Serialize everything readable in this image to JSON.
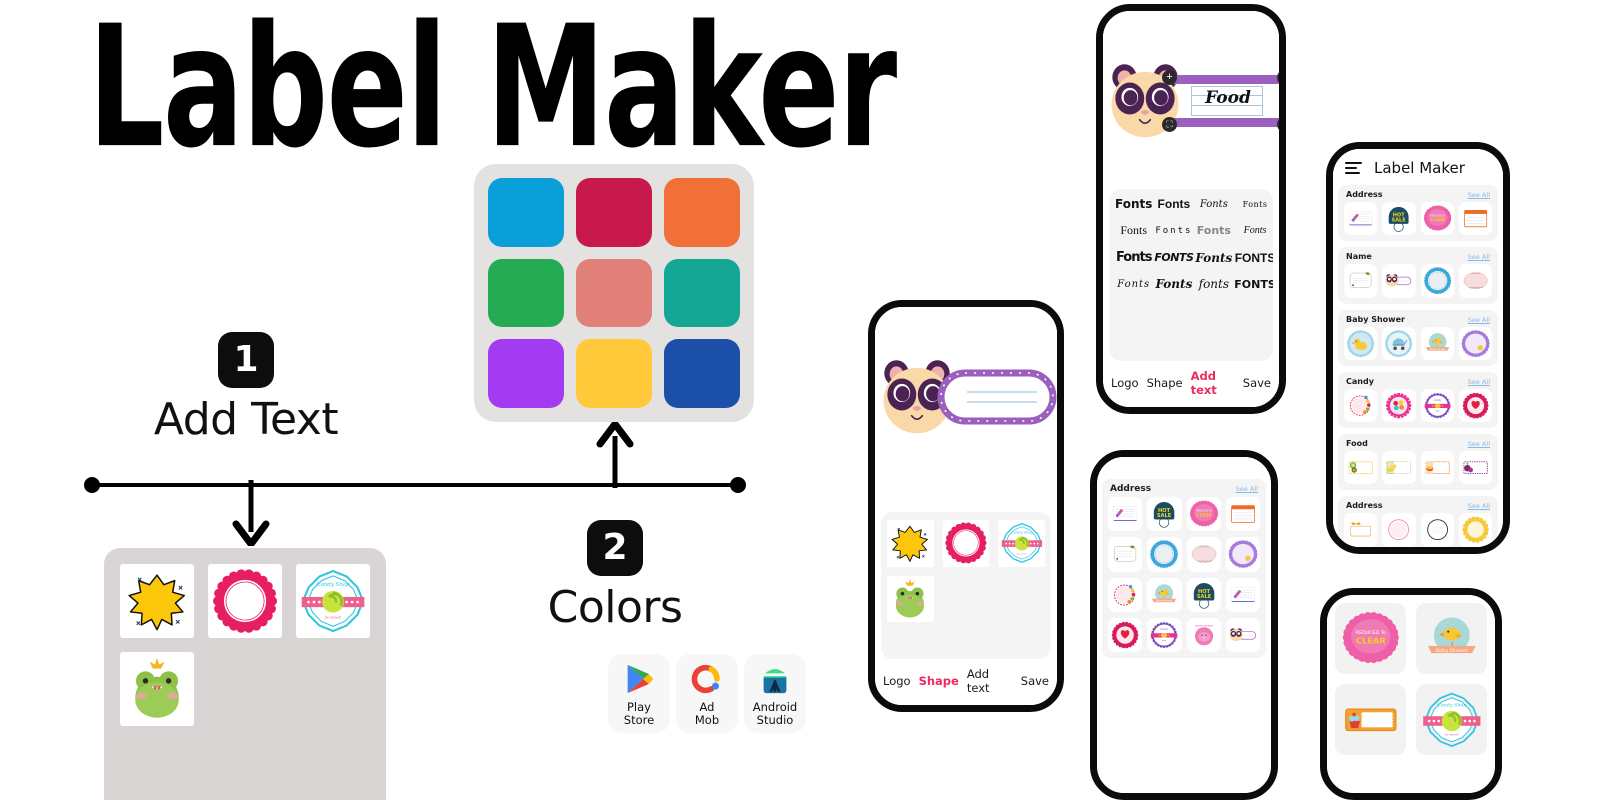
{
  "hero": {
    "title": "Label Maker"
  },
  "steps": [
    {
      "number": "1",
      "label": "Add Text"
    },
    {
      "number": "2",
      "label": "Colors"
    }
  ],
  "palette": {
    "name": "color-palette",
    "colors": [
      "#0a9fd8",
      "#c8194c",
      "#f07038",
      "#25ab53",
      "#e08079",
      "#15a795",
      "#a33cf0",
      "#ffc93a",
      "#1b4fa8"
    ]
  },
  "shape_panel": {
    "thumbnails": [
      {
        "name": "starburst-shape",
        "kind": "starburst"
      },
      {
        "name": "pink-circle-frame-shape",
        "kind": "pinkcircle"
      },
      {
        "name": "candy-badge-shape",
        "kind": "candybadge"
      },
      {
        "name": "frog-logo-shape",
        "kind": "frog"
      }
    ]
  },
  "stores": [
    {
      "name": "play-store-badge",
      "icon": "play-store-icon",
      "line1": "Play",
      "line2": "Store"
    },
    {
      "name": "admob-badge",
      "icon": "admob-icon",
      "line1": "Ad",
      "line2": "Mob"
    },
    {
      "name": "android-studio-badge",
      "icon": "android-studio-icon",
      "line1": "Android",
      "line2": "Studio"
    }
  ],
  "phone_fonts": {
    "canvas": {
      "logo": "panda-logo",
      "text_value": "Food",
      "handles": [
        {
          "name": "add-handle",
          "glyph": "+"
        },
        {
          "name": "rotate-handle",
          "glyph": "↻"
        },
        {
          "name": "crop-handle",
          "glyph": "❑"
        },
        {
          "name": "resize-handle",
          "glyph": "↔"
        }
      ]
    },
    "font_options": [
      "Fonts",
      "Fonts",
      "Fonts",
      "Fonts",
      "Fonts",
      "Fonts",
      "Fonts",
      "Fonts",
      "Fonts",
      "FONTS",
      "Fonts",
      "FONTS",
      "Fonts",
      "Fonts",
      "fonts",
      "FONTS"
    ],
    "toolbar": [
      {
        "label": "Logo",
        "active": false
      },
      {
        "label": "Shape",
        "active": false
      },
      {
        "label": "Add text",
        "active": true
      },
      {
        "label": "Save",
        "active": false
      }
    ]
  },
  "phone_shape": {
    "canvas": {
      "logo": "panda-logo",
      "label_shape": "purple-pill-label"
    },
    "shape_thumbs": [
      {
        "name": "starburst-shape",
        "kind": "starburst"
      },
      {
        "name": "pink-circle-frame-shape",
        "kind": "pinkcircle"
      },
      {
        "name": "candy-badge-shape",
        "kind": "candybadge"
      },
      {
        "name": "frog-logo-shape",
        "kind": "frog"
      }
    ],
    "toolbar": [
      {
        "label": "Logo",
        "active": false
      },
      {
        "label": "Shape",
        "active": true
      },
      {
        "label": "Add text",
        "active": false
      },
      {
        "label": "Save",
        "active": false
      }
    ]
  },
  "phone_gallery_main": {
    "header": {
      "menu_icon": "hamburger-menu-icon",
      "title": "Label Maker"
    },
    "see_all_label": "See All",
    "categories": [
      {
        "name": "Address",
        "items": [
          "notepad-lines",
          "hot-sale-blue",
          "reduced-to-clear-pink",
          "orange-card"
        ]
      },
      {
        "name": "Name",
        "items": [
          "leaf-frame",
          "panda-pill",
          "blue-scallop",
          "pink-oval"
        ]
      },
      {
        "name": "Baby Shower",
        "items": [
          "duck-badge",
          "stroller-badge",
          "bird-banner",
          "purple-scallop"
        ]
      },
      {
        "name": "Candy",
        "items": [
          "candy-circle",
          "pink-gear-candy",
          "candy-day-badge",
          "pink-ribbon-badge"
        ]
      },
      {
        "name": "Food",
        "items": [
          "kiwi-card",
          "corn-card",
          "soup-card",
          "berry-card"
        ]
      },
      {
        "name": "Address",
        "items": [
          "bow-frame",
          "pink-circle",
          "dark-circle",
          "sun-badge"
        ]
      }
    ]
  },
  "phone_gallery_address": {
    "see_all_label": "See All",
    "category": {
      "name": "Address"
    },
    "grid": [
      "notepad-lines",
      "hot-sale-blue",
      "reduced-to-clear-pink",
      "orange-card",
      "leaf-frame",
      "blue-scallop",
      "pink-oval",
      "purple-scallop",
      "candy-circle",
      "bird-banner",
      "hot-sale-blue",
      "notepad-lines",
      "pink-ribbon-badge",
      "candy-day-badge",
      "pink-bird-badge",
      "panda-pill"
    ]
  },
  "phone_gallery_detail": {
    "items": [
      "reduced-to-clear-pink",
      "bird-banner",
      "cupcake-card",
      "candy-lolly-badge"
    ]
  }
}
